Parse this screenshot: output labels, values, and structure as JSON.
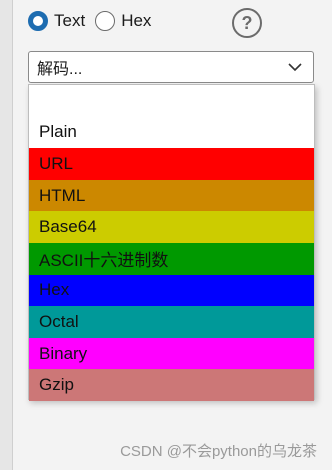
{
  "mode": {
    "text_label": "Text",
    "hex_label": "Hex",
    "selected": "Text"
  },
  "help_icon_glyph": "?",
  "dropdown": {
    "value": "解码..."
  },
  "options": [
    {
      "label": "",
      "color": "#ffffff"
    },
    {
      "label": "Plain",
      "color": "#ffffff"
    },
    {
      "label": "URL",
      "color": "#ff0000"
    },
    {
      "label": "HTML",
      "color": "#cc8800"
    },
    {
      "label": "Base64",
      "color": "#cccc00"
    },
    {
      "label": "ASCII十六进制数",
      "color": "#009900"
    },
    {
      "label": "Hex",
      "color": "#0000ff"
    },
    {
      "label": "Octal",
      "color": "#009999"
    },
    {
      "label": "Binary",
      "color": "#ff00ff"
    },
    {
      "label": "Gzip",
      "color": "#cc7777"
    }
  ],
  "watermark": "CSDN @不会python的乌龙茶"
}
